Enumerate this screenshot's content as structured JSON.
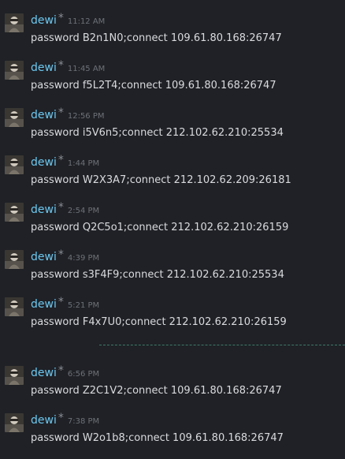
{
  "messages": [
    {
      "username": "dewi",
      "marker": "*",
      "time": "11:12 AM",
      "text": "password B2n1N0;connect 109.61.80.168:26747"
    },
    {
      "username": "dewi",
      "marker": "*",
      "time": "11:45 AM",
      "text": "password f5L2T4;connect 109.61.80.168:26747"
    },
    {
      "username": "dewi",
      "marker": "*",
      "time": "12:56 PM",
      "text": "password i5V6n5;connect 212.102.62.210:25534"
    },
    {
      "username": "dewi",
      "marker": "*",
      "time": "1:44 PM",
      "text": "password W2X3A7;connect 212.102.62.209:26181"
    },
    {
      "username": "dewi",
      "marker": "*",
      "time": "2:54 PM",
      "text": "password Q2C5o1;connect 212.102.62.210:26159"
    },
    {
      "username": "dewi",
      "marker": "*",
      "time": "4:39 PM",
      "text": "password s3F4F9;connect 212.102.62.210:25534"
    },
    {
      "username": "dewi",
      "marker": "*",
      "time": "5:21 PM",
      "text": "password F4x7U0;connect 212.102.62.210:26159"
    },
    {
      "username": "dewi",
      "marker": "*",
      "time": "6:56 PM",
      "text": "password Z2C1V2;connect 109.61.80.168:26747"
    },
    {
      "username": "dewi",
      "marker": "*",
      "time": "7:38 PM",
      "text": "password W2o1b8;connect 109.61.80.168:26747"
    }
  ],
  "avatar_icon": "user-avatar-icon",
  "colors": {
    "background": "#1f2126",
    "username": "#6cc8f0",
    "timestamp": "#6e7178",
    "message_text": "#d9dbde",
    "divider": "#3d7a66"
  }
}
